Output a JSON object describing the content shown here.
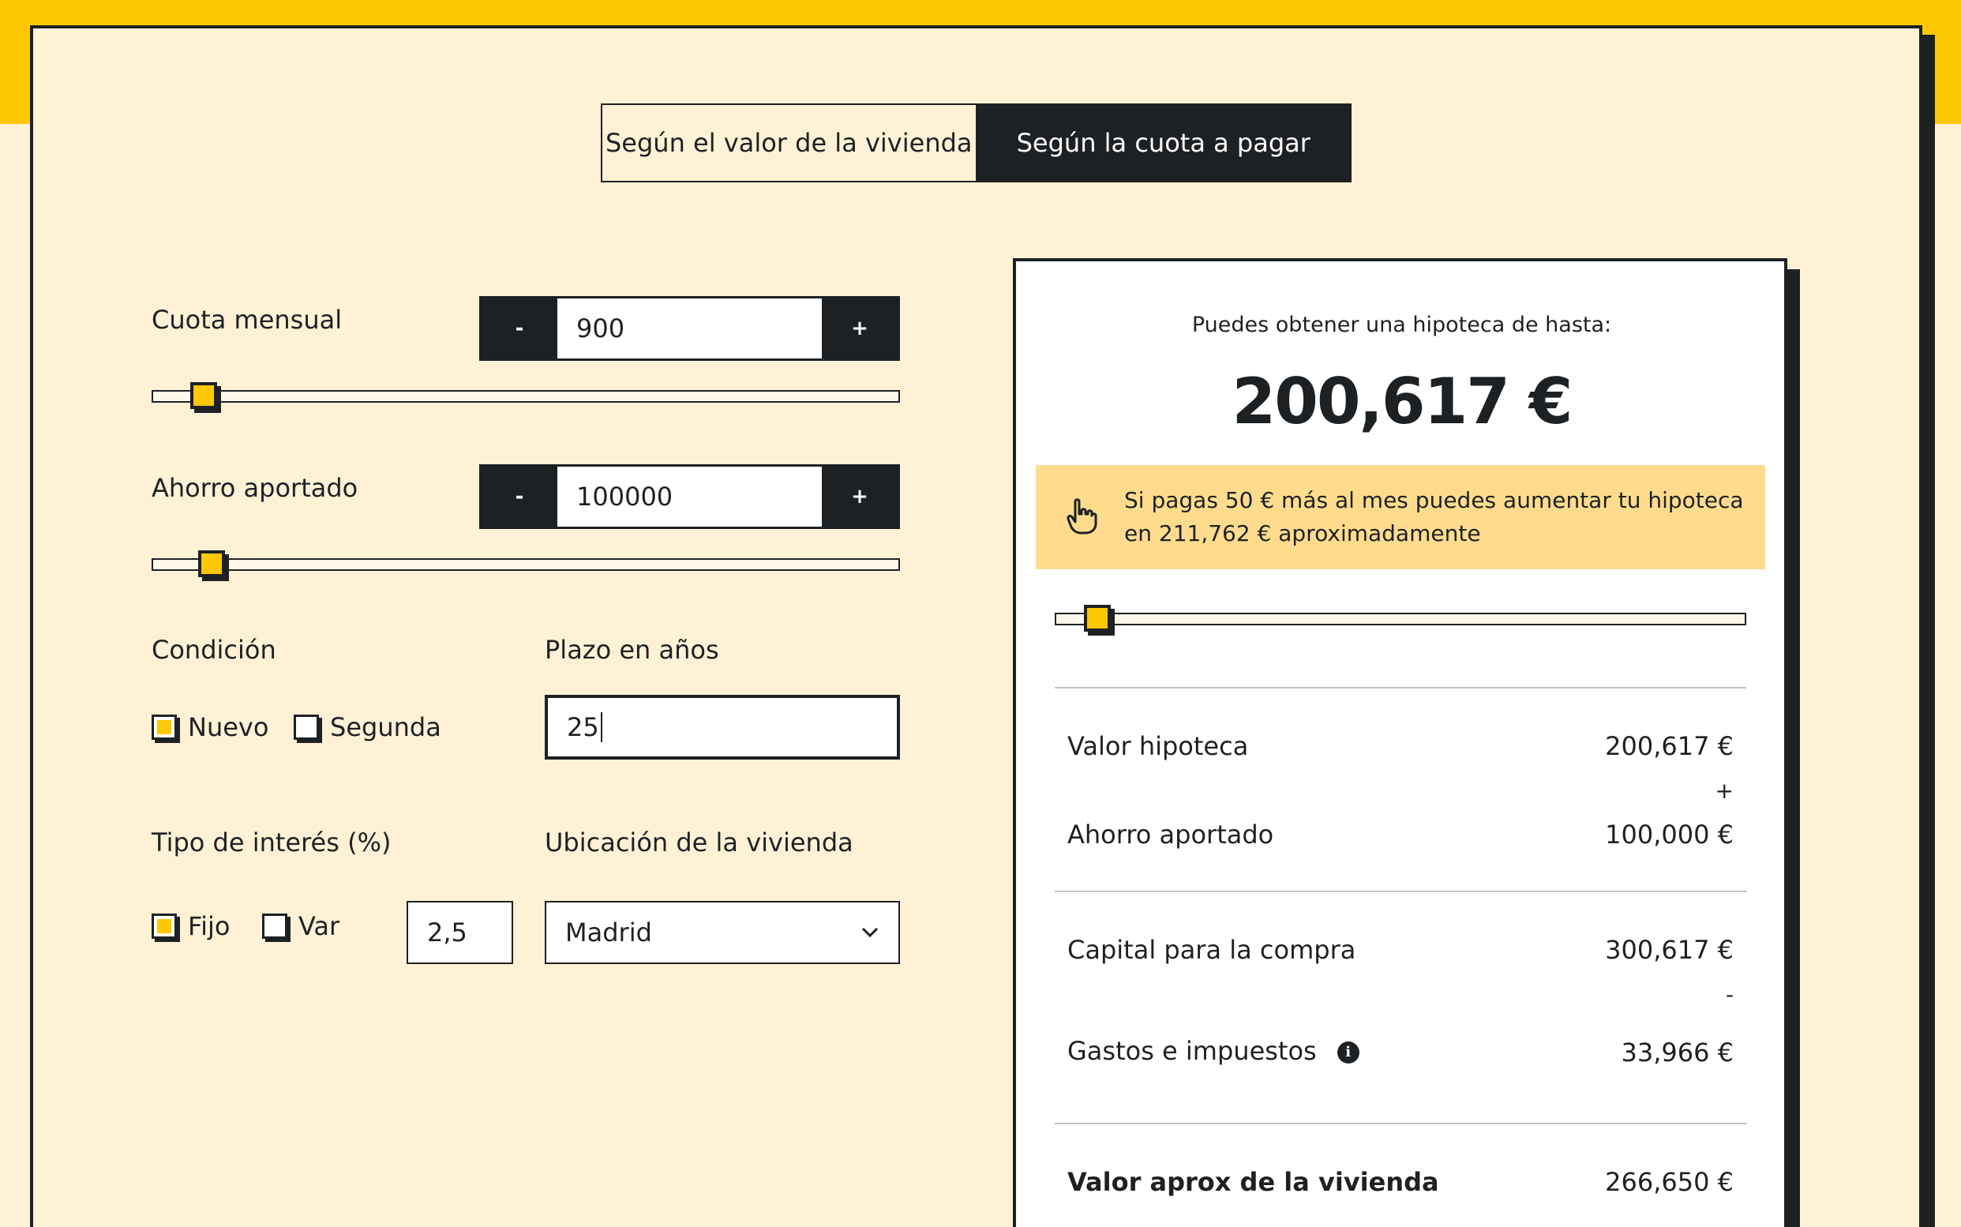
{
  "tabs": {
    "by_value": "Según el valor de la vivienda",
    "by_payment": "Según la cuota a pagar"
  },
  "monthly": {
    "label": "Cuota mensual",
    "value": "900",
    "minus": "-",
    "plus": "+",
    "slider_level": 0.05
  },
  "savings": {
    "label": "Ahorro aportado",
    "value": "100000",
    "minus": "-",
    "plus": "+",
    "slider_level": 0.06
  },
  "condition": {
    "label": "Condición",
    "options": [
      {
        "label": "Nuevo",
        "checked": true
      },
      {
        "label": "Segunda",
        "checked": false
      }
    ]
  },
  "term": {
    "label": "Plazo en años",
    "value": "25"
  },
  "interest": {
    "label": "Tipo de interés (%)",
    "options": [
      {
        "label": "Fijo",
        "checked": true
      },
      {
        "label": "Var",
        "checked": false
      }
    ],
    "value": "2,5"
  },
  "location": {
    "label": "Ubicación de la vivienda",
    "selected": "Madrid"
  },
  "result": {
    "heading": "Puedes obtener una hipoteca de hasta:",
    "amount": "200,617 €",
    "tip": "Si pagas 50 € más al mes puedes aumentar tu hipoteca en 211,762 € aproximadamente",
    "slider_level": 0.04,
    "rows": {
      "mortgage_label": "Valor hipoteca",
      "mortgage_value": "200,617 €",
      "plus": "+",
      "savings_label": "Ahorro aportado",
      "savings_value": "100,000 €",
      "capital_label": "Capital para la compra",
      "capital_value": "300,617 €",
      "minus": "-",
      "costs_label": "Gastos e impuestos",
      "costs_value": "33,966 €",
      "home_label": "Valor aprox de la vivienda",
      "home_value": "266,650 €"
    }
  },
  "icons": {
    "info": "i"
  },
  "colors": {
    "accent": "#ffc805",
    "background": "#fff1d6",
    "dark": "#1e2124",
    "tip_bg": "#ffdc8d"
  }
}
